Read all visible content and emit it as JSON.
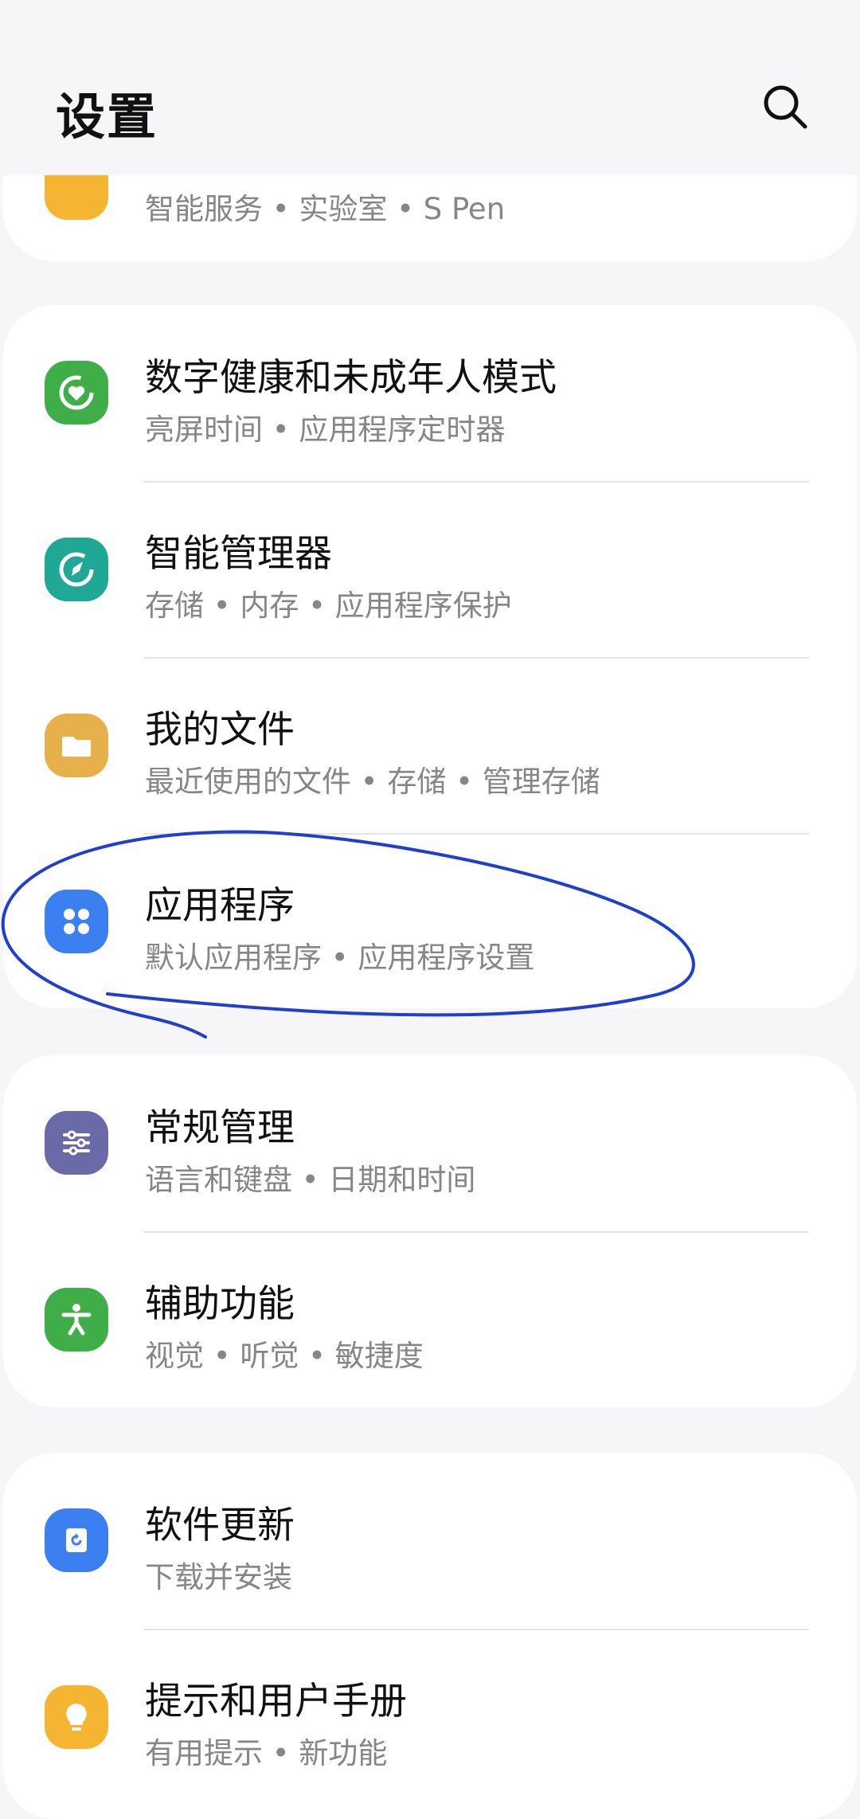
{
  "header": {
    "title": "设置"
  },
  "top_partial": {
    "subtitle": "智能服务 • 实验室 • S Pen"
  },
  "groups": [
    {
      "items": [
        {
          "label": "数字健康和未成年人模式",
          "subtitle": "亮屏时间 • 应用程序定时器",
          "icon": "digital-wellbeing-icon",
          "color": "#3fae49"
        },
        {
          "label": "智能管理器",
          "subtitle": "存储 • 内存 • 应用程序保护",
          "icon": "device-care-icon",
          "color": "#1fa895"
        },
        {
          "label": "我的文件",
          "subtitle": "最近使用的文件 • 存储 • 管理存储",
          "icon": "folder-icon",
          "color": "#e6b04a"
        },
        {
          "label": "应用程序",
          "subtitle": "默认应用程序 • 应用程序设置",
          "icon": "apps-icon",
          "color": "#3b7ff0"
        }
      ]
    },
    {
      "items": [
        {
          "label": "常规管理",
          "subtitle": "语言和键盘 • 日期和时间",
          "icon": "sliders-icon",
          "color": "#6a6aa8"
        },
        {
          "label": "辅助功能",
          "subtitle": "视觉 • 听觉 • 敏捷度",
          "icon": "accessibility-icon",
          "color": "#3fae49"
        }
      ]
    },
    {
      "items": [
        {
          "label": "软件更新",
          "subtitle": "下载并安装",
          "icon": "software-update-icon",
          "color": "#3b7ff0"
        },
        {
          "label": "提示和用户手册",
          "subtitle": "有用提示 • 新功能",
          "icon": "lightbulb-icon",
          "color": "#f5b431"
        }
      ]
    }
  ],
  "colors": {
    "background": "#f6f6f8",
    "card": "#ffffff",
    "annotation": "#1f3fcf"
  }
}
